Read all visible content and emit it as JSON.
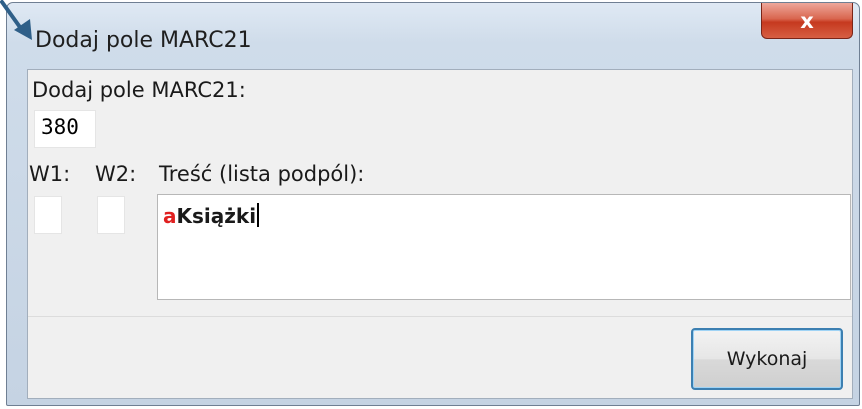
{
  "window": {
    "title": "Dodaj pole MARC21",
    "close_glyph": "x"
  },
  "form": {
    "field_label": "Dodaj pole MARC21:",
    "field_code": "380",
    "w1_label": "W1:",
    "w2_label": "W2:",
    "w1_value": "",
    "w2_value": "",
    "content_label": "Treść (lista podpól):",
    "content": {
      "subfield_code": "a",
      "subfield_value": "Książki"
    },
    "submit_label": "Wykonaj"
  },
  "colors": {
    "subfield_code": "#e02020",
    "close_button": "#c6391f",
    "focus_border": "#3c7fb1",
    "cursor": "#2f5f88"
  },
  "icons": {
    "cursor": "pointer-arrow-icon",
    "close": "close-icon"
  }
}
